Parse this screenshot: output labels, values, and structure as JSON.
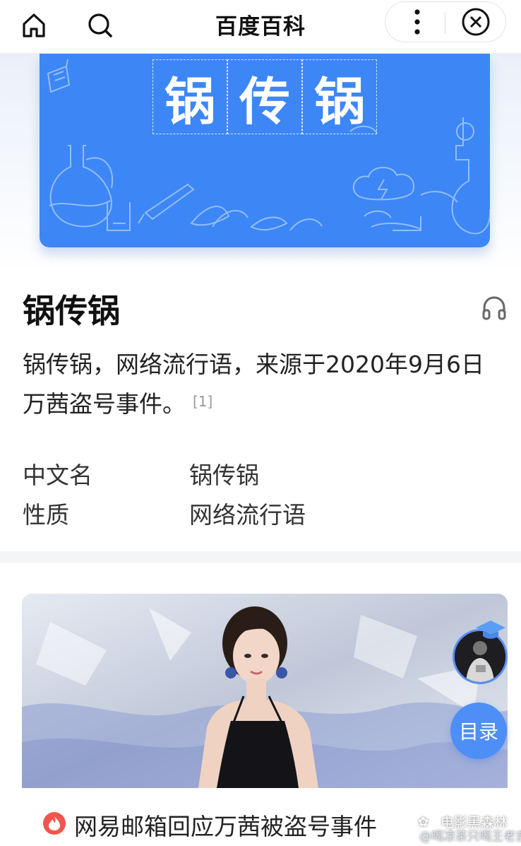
{
  "navbar": {
    "title": "百度百科",
    "home_icon": "home-icon",
    "search_icon": "search-icon",
    "more_icon": "more-vertical-icon",
    "close_icon": "close-circle-icon"
  },
  "banner": {
    "title_chars": [
      "锅",
      "传",
      "锅"
    ],
    "background_color": "#3d86f5"
  },
  "entry": {
    "title": "锅传锅",
    "summary": "锅传锅，网络流行语，来源于2020年9月6日万茜盗号事件。",
    "reference": "[1]",
    "audio_icon": "headphones-icon"
  },
  "infobox": [
    {
      "key": "中文名",
      "value": "锅传锅"
    },
    {
      "key": "性质",
      "value": "网络流行语"
    }
  ],
  "news": {
    "headline": "网易邮箱回应万茜被盗号事件",
    "badge_icon": "fire-icon",
    "badge_color": "#f0564c"
  },
  "floating": {
    "toc_label": "目录",
    "avatar_icon": "user-avatar",
    "toc_color": "#4e8ef7"
  },
  "watermark": {
    "line1": "电影黑森林",
    "line2": "@喝凉茶只喝王老吉"
  }
}
